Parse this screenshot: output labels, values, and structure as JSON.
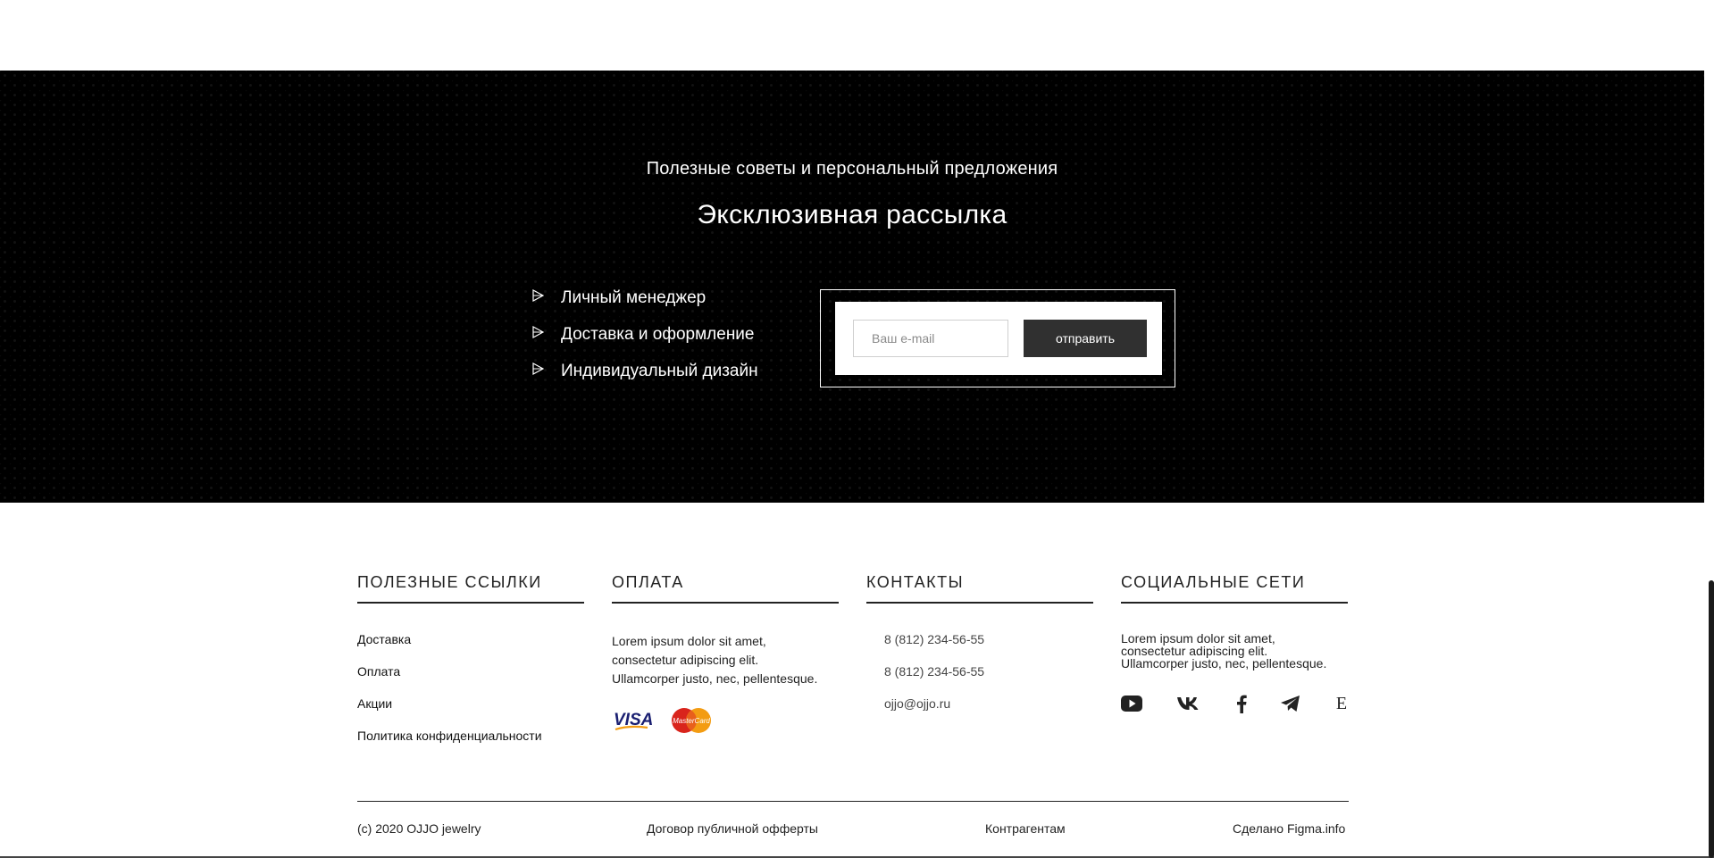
{
  "newsletter": {
    "subtitle": "Полезные советы и персональный предложения",
    "title": "Эксклюзивная рассылка",
    "benefits": [
      {
        "label": "Личный менеджер",
        "icon": "triangle-arrow-icon"
      },
      {
        "label": "Доставка и оформление",
        "icon": "triangle-arrow-icon"
      },
      {
        "label": "Индивидуальный дизайн",
        "icon": "triangle-arrow-icon"
      }
    ],
    "form": {
      "email_placeholder": "Ваш e-mail",
      "submit_label": "отправить"
    }
  },
  "footer": {
    "useful_links": {
      "heading": "ПОЛЕЗНЫЕ ССЫЛКИ",
      "items": [
        "Доставка",
        "Оплата",
        "Акции",
        "Политика конфиденциальности"
      ]
    },
    "payment": {
      "heading": "ОПЛАТА",
      "text_lines": [
        "Lorem ipsum dolor sit amet,",
        "consectetur adipiscing elit.",
        "Ullamcorper justo, nec, pellentesque."
      ],
      "cards": [
        {
          "name": "visa-icon",
          "label": "VISA"
        },
        {
          "name": "mastercard-icon",
          "label": "MasterCard"
        }
      ]
    },
    "contacts": {
      "heading": "КОНТАКТЫ",
      "phone_1": "8 (812) 234-56-55",
      "phone_2": "8 (812) 234-56-55",
      "email": "ojjo@ojjo.ru"
    },
    "social": {
      "heading": "СОЦИАЛЬНЫЕ СЕТИ",
      "text_lines": [
        "Lorem ipsum dolor sit amet,",
        "consectetur adipiscing elit.",
        "Ullamcorper justo, nec, pellentesque."
      ],
      "icons": [
        "youtube-icon",
        "vk-icon",
        "facebook-icon",
        "telegram-icon",
        "etsy-icon"
      ],
      "etsy_glyph": "E"
    },
    "bottom": {
      "copyright": "(c) 2020 OJJO jewelry",
      "offer": "Договор публичной офферты",
      "contractors": "Контрагентам",
      "made_by": "Сделано Figma.info"
    }
  },
  "colors": {
    "newsletter_bg": "#000000",
    "button_bg": "#303030",
    "text_dark": "#222222",
    "mastercard_red": "#d9241c",
    "mastercard_orange": "#f39c12",
    "visa_blue": "#1a1f71"
  }
}
